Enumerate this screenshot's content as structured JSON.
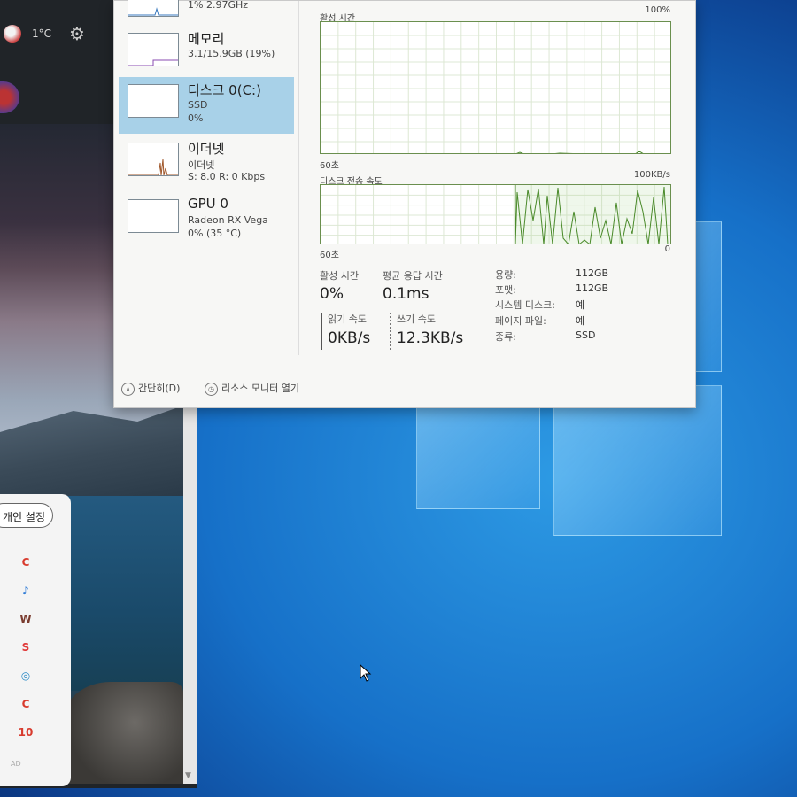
{
  "widgets": {
    "temperature": "1°C",
    "settings_button": "개인 설정",
    "ad_label": "AD",
    "apps": [
      {
        "glyph": "C",
        "color": "#d83b2e"
      },
      {
        "glyph": "♪",
        "color": "#2f7bd6"
      },
      {
        "glyph": "W",
        "color": "#7a3b2e"
      },
      {
        "glyph": "S",
        "color": "#e03a3a"
      },
      {
        "glyph": "◎",
        "color": "#2a8ac6"
      },
      {
        "glyph": "C",
        "color": "#d83b2e"
      },
      {
        "glyph": "10",
        "color": "#d83b2e"
      }
    ]
  },
  "task_manager": {
    "sidebar": [
      {
        "name": "",
        "line1": "1% 2.97GHz",
        "line2": ""
      },
      {
        "name": "메모리",
        "line1": "3.1/15.9GB (19%)",
        "line2": ""
      },
      {
        "name": "디스크 0(C:)",
        "line1": "SSD",
        "line2": "0%"
      },
      {
        "name": "이더넷",
        "line1": "이더넷",
        "line2": "S: 8.0  R: 0 Kbps"
      },
      {
        "name": "GPU 0",
        "line1": "Radeon RX Vega",
        "line2": "0% (35 °C)"
      }
    ],
    "graph1": {
      "label": "활성 시간",
      "max": "100%",
      "time": "60초",
      "min": ""
    },
    "graph2": {
      "label": "디스크 전송 속도",
      "max": "100KB/s",
      "time": "60초",
      "min": "0"
    },
    "stats": {
      "active_time_label": "활성 시간",
      "active_time_value": "0%",
      "avg_response_label": "평균 응답 시간",
      "avg_response_value": "0.1ms",
      "read_label": "읽기 속도",
      "read_value": "0KB/s",
      "write_label": "쓰기 속도",
      "write_value": "12.3KB/s"
    },
    "properties": [
      {
        "label": "용량:",
        "value": "112GB"
      },
      {
        "label": "포맷:",
        "value": "112GB"
      },
      {
        "label": "시스템 디스크:",
        "value": "예"
      },
      {
        "label": "페이지 파일:",
        "value": "예"
      },
      {
        "label": "종류:",
        "value": "SSD"
      }
    ],
    "footer": {
      "fewer_details": "간단히(D)",
      "open_resource_monitor": "리소스 모니터 열기"
    }
  }
}
